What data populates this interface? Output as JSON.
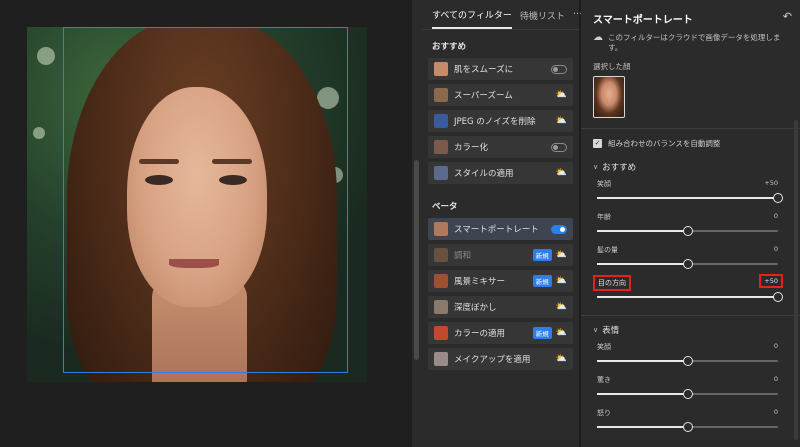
{
  "filters_panel": {
    "tabs": [
      {
        "label": "すべてのフィルター",
        "active": true
      },
      {
        "label": "待機リスト",
        "active": false
      }
    ],
    "more_label": "···",
    "sections": [
      {
        "title": "おすすめ",
        "items": [
          {
            "label": "肌をスムーズに",
            "control": "toggle",
            "on": false,
            "thumb_color": "#c98a6a"
          },
          {
            "label": "スーパーズーム",
            "control": "cloud",
            "thumb_color": "#8a6a4a"
          },
          {
            "label": "JPEG のノイズを削除",
            "control": "cloud",
            "thumb_color": "#3a5aa0"
          },
          {
            "label": "カラー化",
            "control": "toggle",
            "on": false,
            "thumb_color": "#7a5a48"
          },
          {
            "label": "スタイルの適用",
            "control": "cloud",
            "thumb_color": "#5a6a8a"
          }
        ]
      },
      {
        "title": "ベータ",
        "items": [
          {
            "label": "スマートポートレート",
            "control": "toggle",
            "on": true,
            "selected": true,
            "thumb_color": "#b07a5a"
          },
          {
            "label": "調和",
            "control": "badge-cloud",
            "badge": "新規",
            "disabled": true,
            "thumb_color": "#6a5040"
          },
          {
            "label": "風景ミキサー",
            "control": "badge-cloud",
            "badge": "新規",
            "thumb_color": "#a05030"
          },
          {
            "label": "深度ぼかし",
            "control": "cloud",
            "thumb_color": "#8a7a6a"
          },
          {
            "label": "カラーの適用",
            "control": "badge-cloud",
            "badge": "新規",
            "thumb_color": "#c04a30"
          },
          {
            "label": "メイクアップを適用",
            "control": "cloud",
            "thumb_color": "#9a8a8a"
          }
        ]
      }
    ]
  },
  "settings_panel": {
    "title": "スマートポートレート",
    "undo_icon": "undo-icon",
    "cloud_note": "このフィルターはクラウドで画像データを処理します。",
    "selected_face_label": "選択した顔",
    "auto_balance_label": "組み合わせのバランスを自動調整",
    "auto_balance_checked": true,
    "groups": [
      {
        "title": "おすすめ",
        "sliders": [
          {
            "label": "笑顔",
            "value": "+50",
            "fraction": 1.0
          },
          {
            "label": "年齢",
            "value": "0",
            "fraction": 0.5
          },
          {
            "label": "髪の量",
            "value": "0",
            "fraction": 0.5
          },
          {
            "label": "目の方向",
            "value": "+50",
            "fraction": 1.0,
            "highlighted": true
          }
        ]
      },
      {
        "title": "表情",
        "sliders": [
          {
            "label": "笑顔",
            "value": "0",
            "fraction": 0.5
          },
          {
            "label": "驚き",
            "value": "0",
            "fraction": 0.5
          },
          {
            "label": "怒り",
            "value": "0",
            "fraction": 0.5
          }
        ]
      }
    ]
  },
  "colors": {
    "accent": "#2d7ee8",
    "highlight": "#e2231a",
    "panel": "#2b2b2b"
  }
}
